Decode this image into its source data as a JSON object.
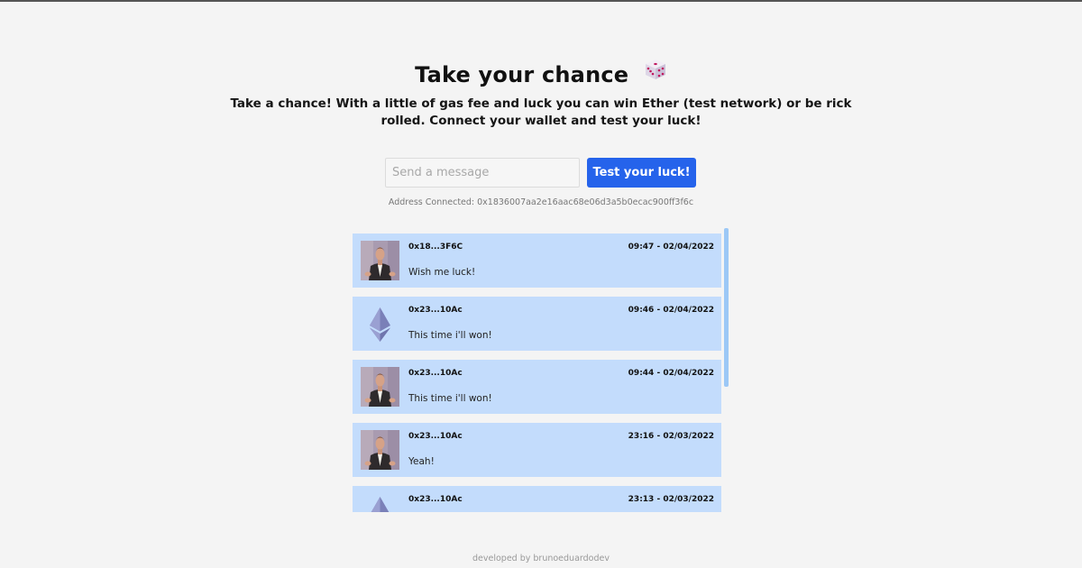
{
  "header": {
    "title": "Take your chance",
    "title_icon": "game-die-icon",
    "subtitle": "Take a chance! With a little of gas fee and luck you can win Ether (test network) or be rick rolled. Connect your wallet and test your luck!"
  },
  "form": {
    "message_placeholder": "Send a message",
    "message_value": "",
    "submit_label": "Test your luck!",
    "accent_color": "#2563eb"
  },
  "connection": {
    "address_text": "Address Connected: 0x1836007aa2e16aac68e06d3a5b0ecac900ff3f6c"
  },
  "messages": [
    {
      "address": "0x18...3F6C",
      "time": "09:47 - 02/04/2022",
      "message": "Wish me luck!",
      "avatar": "rick-roll-avatar"
    },
    {
      "address": "0x23...10Ac",
      "time": "09:46 - 02/04/2022",
      "message": "This time i'll won!",
      "avatar": "ethereum-icon"
    },
    {
      "address": "0x23...10Ac",
      "time": "09:44 - 02/04/2022",
      "message": "This time i'll won!",
      "avatar": "rick-roll-avatar"
    },
    {
      "address": "0x23...10Ac",
      "time": "23:16 - 02/03/2022",
      "message": "Yeah!",
      "avatar": "rick-roll-avatar"
    },
    {
      "address": "0x23...10Ac",
      "time": "23:13 - 02/03/2022",
      "message": "",
      "avatar": "ethereum-icon"
    }
  ],
  "colors": {
    "card_background": "#c3dcfc",
    "page_background": "#f4f4f4",
    "scrollbar": "#9cc8f6"
  },
  "footer": {
    "text": "developed by brunoeduardodev"
  }
}
